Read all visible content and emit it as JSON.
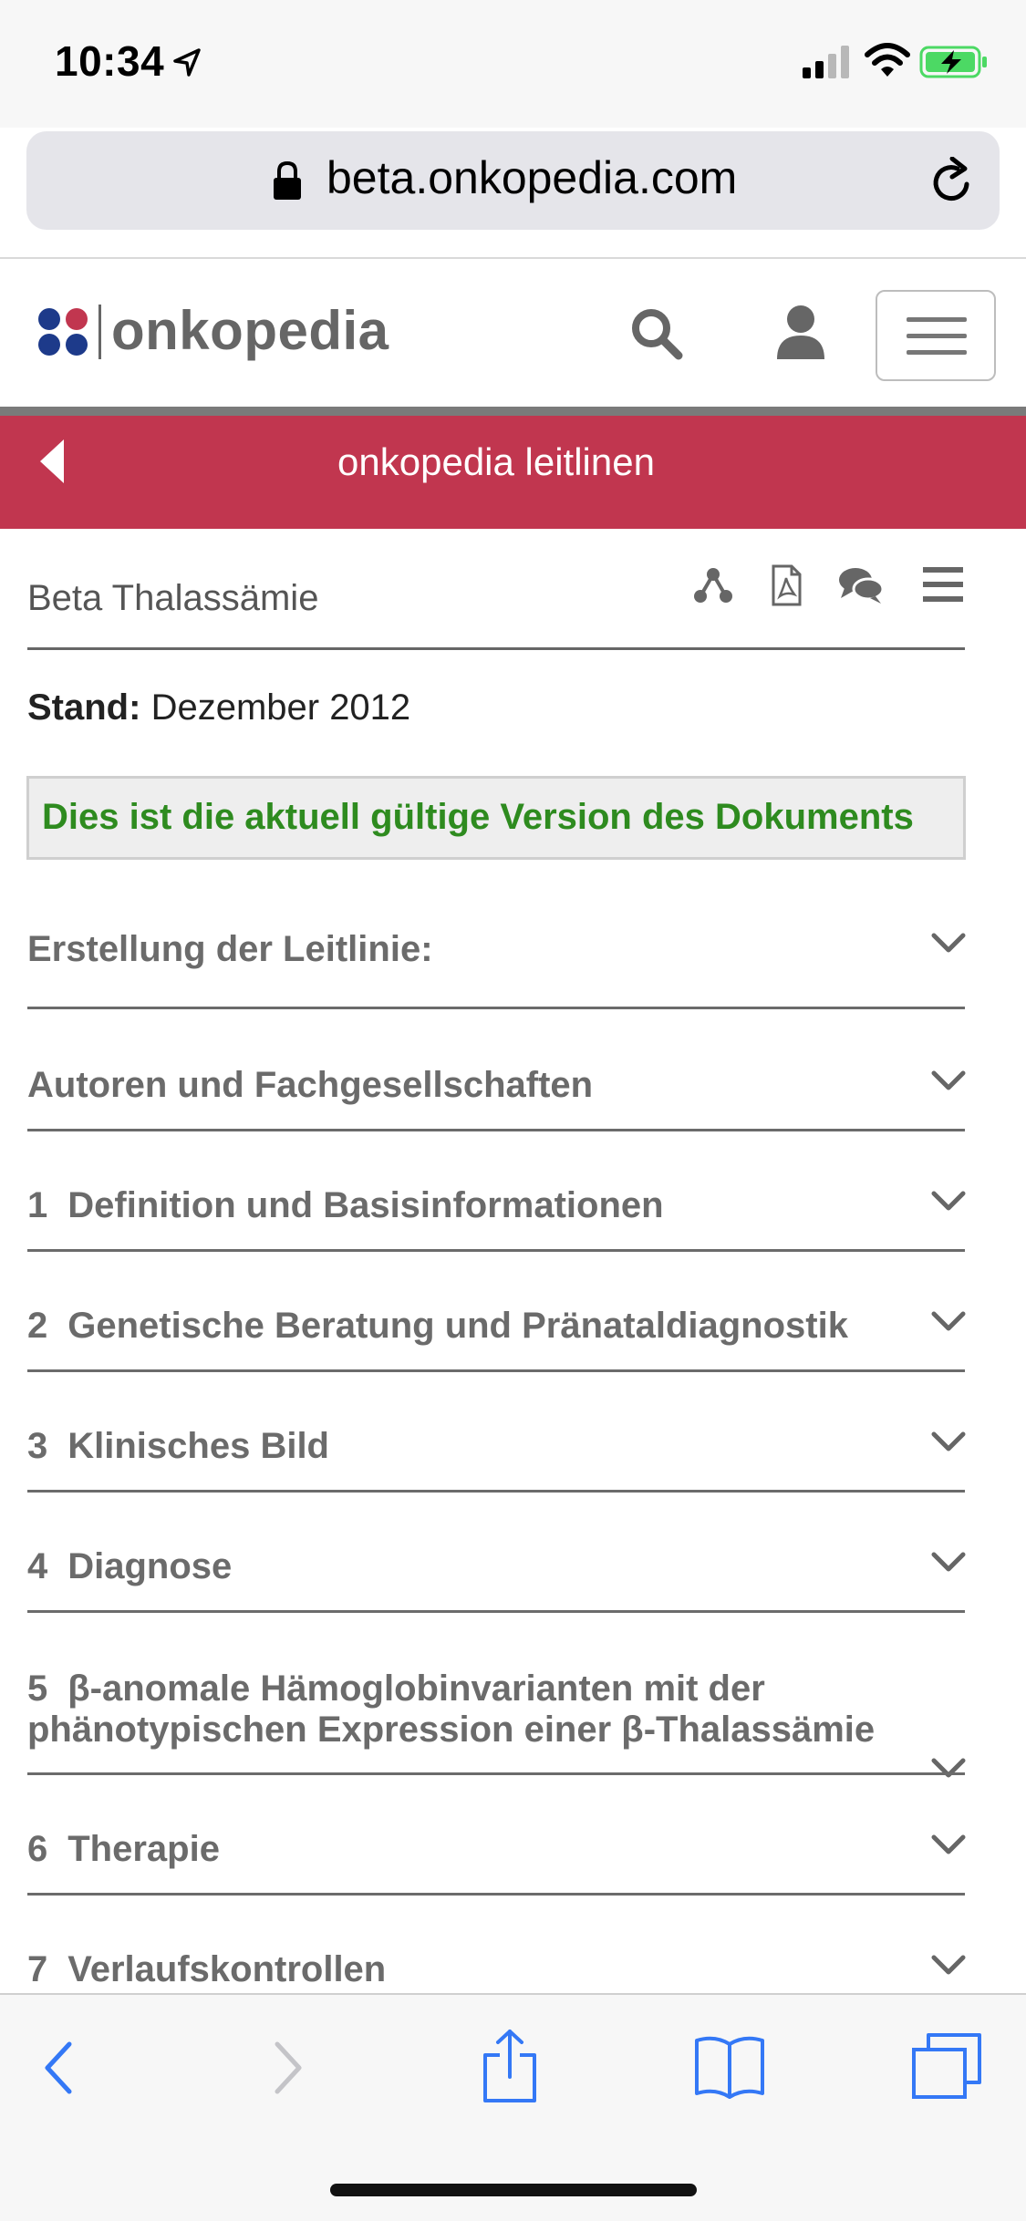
{
  "status_bar": {
    "time": "10:34"
  },
  "browser": {
    "url": "beta.onkopedia.com"
  },
  "site": {
    "logo_text": "onkopedia"
  },
  "banner": {
    "title": "onkopedia leitlinen"
  },
  "document": {
    "title": "Beta Thalassämie",
    "stand_label": "Stand:",
    "stand_value": "Dezember 2012",
    "version_notice": "Dies ist die aktuell gültige Version des Dokuments"
  },
  "sections": [
    {
      "num": "",
      "label": "Erstellung der Leitlinie:"
    },
    {
      "num": "",
      "label": "Autoren und Fachgesellschaften"
    },
    {
      "num": "1",
      "label": "Definition und Basisinformationen"
    },
    {
      "num": "2",
      "label": "Genetische Beratung und Pränataldiagnostik"
    },
    {
      "num": "3",
      "label": "Klinisches Bild"
    },
    {
      "num": "4",
      "label": "Diagnose"
    },
    {
      "num": "5",
      "label": "β-anomale Hämoglobinvarianten mit der",
      "label_line2": "phänotypischen Expression einer β-Thalassämie"
    },
    {
      "num": "6",
      "label": "Therapie"
    },
    {
      "num": "7",
      "label": "Verlaufskontrollen"
    }
  ],
  "colors": {
    "banner": "#c1364f",
    "version_text": "#2e8b1f",
    "ios_blue": "#3478f6"
  }
}
